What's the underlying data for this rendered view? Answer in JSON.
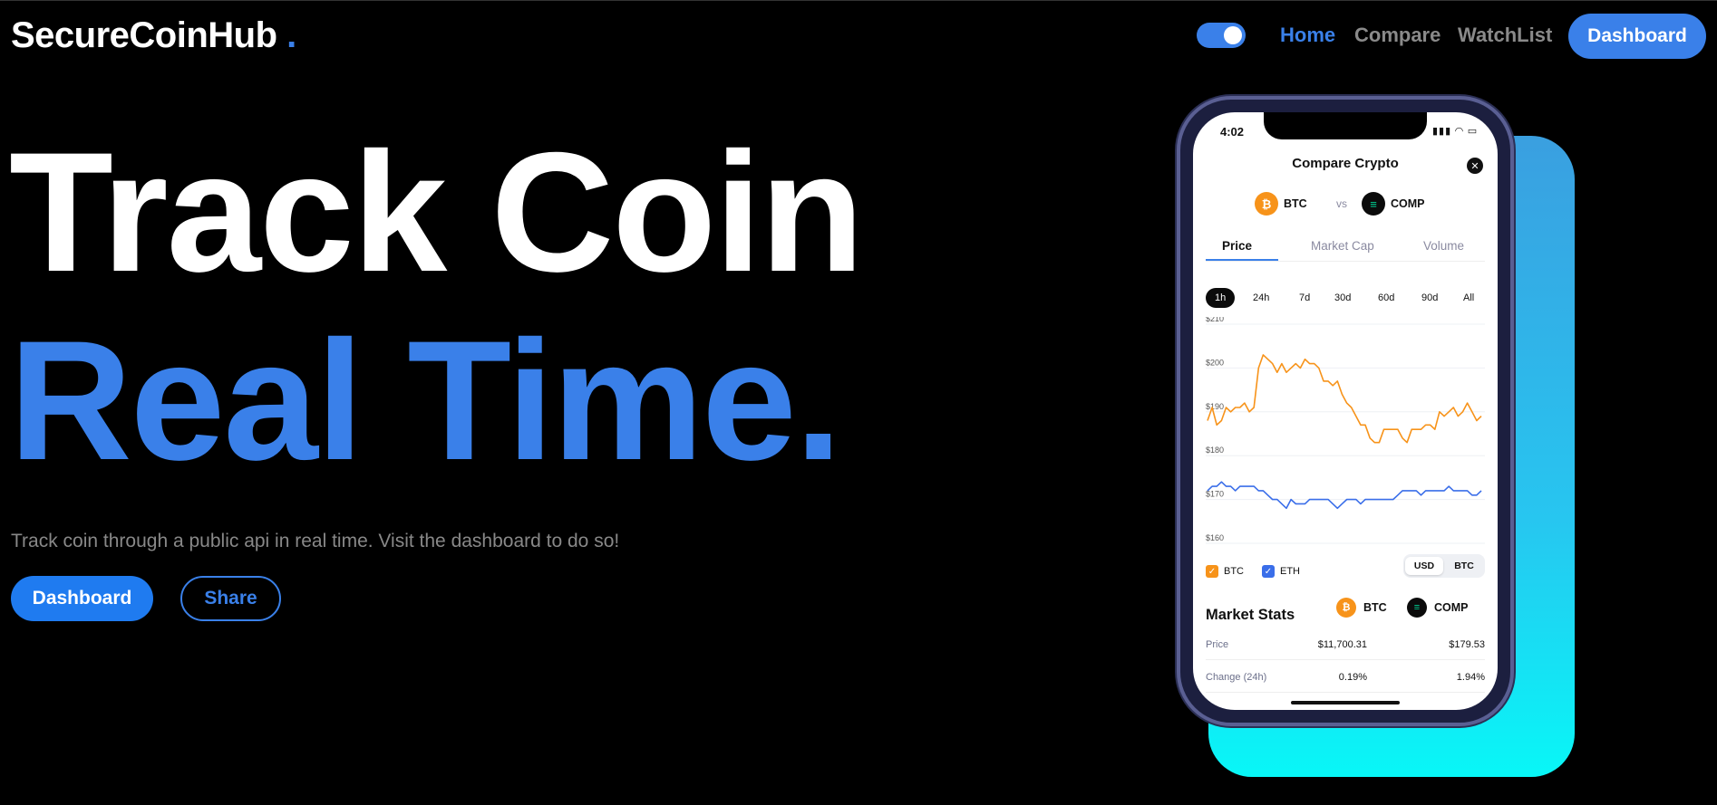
{
  "header": {
    "logo": "SecureCoinHub",
    "logo_dot": ".",
    "nav": {
      "home": "Home",
      "compare": "Compare",
      "watchlist": "WatchList",
      "dashboard": "Dashboard"
    },
    "theme_toggle_on": true
  },
  "hero": {
    "line1": "Track Coin",
    "line2": "Real Time.",
    "subtitle": "Track coin through a public api in real time. Visit the dashboard to do so!",
    "dashboard_btn": "Dashboard",
    "share_btn": "Share"
  },
  "phone": {
    "time": "4:02",
    "status_icons": "▮▮▮ ◠ ▭",
    "title": "Compare Crypto",
    "close": "✕",
    "coin_a": {
      "symbol": "BTC",
      "glyph": "₿"
    },
    "vs": "vs",
    "coin_b": {
      "symbol": "COMP",
      "glyph": "≡"
    },
    "tabs": [
      "Price",
      "Market Cap",
      "Volume"
    ],
    "ranges": [
      "1h",
      "24h",
      "7d",
      "30d",
      "60d",
      "90d",
      "All"
    ],
    "y_ticks": [
      "$210",
      "$200",
      "$190",
      "$180",
      "$170",
      "$160"
    ],
    "legend": {
      "btc": "BTC",
      "eth": "ETH",
      "check": "✓"
    },
    "currency": [
      "USD",
      "BTC"
    ],
    "market_stats": {
      "title": "Market Stats",
      "col_a": "BTC",
      "col_b": "COMP",
      "rows": [
        {
          "label": "Price",
          "a": "$11,700.31",
          "b": "$179.53"
        },
        {
          "label": "Change (24h)",
          "a": "0.19%",
          "b": "1.94%"
        }
      ]
    }
  },
  "colors": {
    "accent": "#3a80e9",
    "btc_line": "#f7931a",
    "eth_line": "#3a6ee9"
  },
  "chart_data": {
    "type": "line",
    "ylim": [
      160,
      210
    ],
    "y_ticks": [
      210,
      200,
      190,
      180,
      170,
      160
    ],
    "x": [
      1,
      2,
      3,
      4,
      5,
      6,
      7,
      8,
      9,
      10,
      11,
      12,
      13,
      14,
      15,
      16,
      17,
      18,
      19,
      20,
      21,
      22,
      23,
      24,
      25,
      26,
      27,
      28,
      29,
      30,
      31,
      32,
      33,
      34,
      35,
      36,
      37,
      38,
      39,
      40,
      41,
      42,
      43,
      44,
      45,
      46,
      47,
      48,
      49,
      50,
      51,
      52,
      53,
      54,
      55,
      56,
      57,
      58,
      59,
      60
    ],
    "series": [
      {
        "name": "BTC",
        "color": "#f7931a",
        "values": [
          188,
          191,
          187,
          188,
          191,
          190,
          191,
          191,
          192,
          190,
          191,
          200,
          203,
          202,
          201,
          199,
          201,
          199,
          200,
          201,
          200,
          202,
          201,
          201,
          200,
          197,
          197,
          196,
          197,
          194,
          192,
          191,
          189,
          187,
          187,
          184,
          183,
          183,
          186,
          186,
          186,
          186,
          184,
          183,
          186,
          186,
          186,
          187,
          187,
          186,
          190,
          189,
          190,
          191,
          189,
          190,
          192,
          190,
          188,
          189
        ]
      },
      {
        "name": "ETH",
        "color": "#3a6ee9",
        "values": [
          172,
          173,
          173,
          174,
          173,
          173,
          172,
          173,
          173,
          173,
          173,
          172,
          172,
          171,
          170,
          170,
          169,
          168,
          170,
          169,
          169,
          169,
          170,
          170,
          170,
          170,
          170,
          169,
          168,
          169,
          170,
          170,
          170,
          169,
          170,
          170,
          170,
          170,
          170,
          170,
          170,
          171,
          172,
          172,
          172,
          172,
          171,
          172,
          172,
          172,
          172,
          172,
          173,
          172,
          172,
          172,
          172,
          171,
          171,
          172
        ]
      }
    ]
  }
}
